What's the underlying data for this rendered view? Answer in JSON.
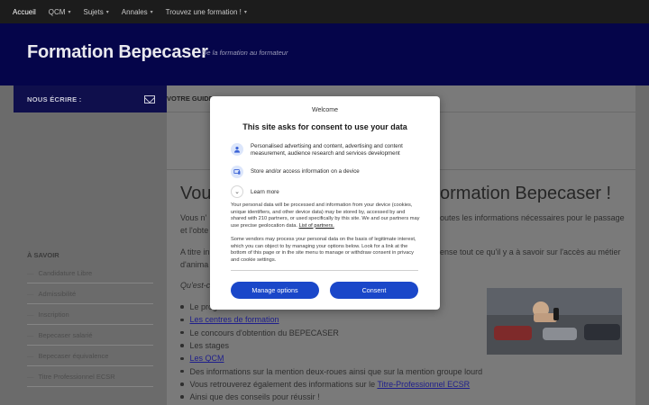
{
  "nav": {
    "items": [
      {
        "label": "Accueil",
        "active": true,
        "dropdown": false
      },
      {
        "label": "QCM",
        "dropdown": true
      },
      {
        "label": "Sujets",
        "dropdown": true
      },
      {
        "label": "Annales",
        "dropdown": true
      },
      {
        "label": "Trouvez une formation !",
        "dropdown": true
      }
    ]
  },
  "header": {
    "title": "Formation Bepecaser",
    "tagline": "De la formation au formateur"
  },
  "sidebar": {
    "contact_label": "NOUS ÉCRIRE :",
    "section_title": "À SAVOIR",
    "items": [
      "Candidature Libre",
      "Admissibilité",
      "Inscription",
      "Bepecaser salarié",
      "Bepecaser équivalence",
      "Titre Professionnel ECSR"
    ]
  },
  "main": {
    "guide_label": "VOTRE GUIDE",
    "heading_left": "Vous",
    "heading_right": "ormation Bepecaser !",
    "p1_left": "Vous n'",
    "p1_right": "outes les informations nécessaires pour le passage",
    "p1b_left": "et l'obte",
    "p2_left": "A titre in",
    "p2_right": "ense tout ce qu'il y a à savoir sur l'accès au métier",
    "p2b_left": "d'anima",
    "question_left": "Qu'est-c",
    "bullets": [
      {
        "text": "Le programme",
        "link": false
      },
      {
        "text": "Les centres de formation",
        "link": true
      },
      {
        "text": "Le concours d'obtention du BEPECASER",
        "link": false
      },
      {
        "text": "Les stages",
        "link": false
      },
      {
        "text": "Les QCM",
        "link": true
      },
      {
        "text": "Des informations sur la mention deux-roues ainsi que sur la mention groupe lourd",
        "link": false
      },
      {
        "text_before": "Vous retrouverez également des informations sur le ",
        "link_text": "Titre-Professionnel ECSR"
      },
      {
        "text": "Ainsi que des conseils pour réussir !",
        "link": false
      }
    ]
  },
  "consent": {
    "welcome": "Welcome",
    "title": "This site asks for consent to use your data",
    "purposes": [
      {
        "icon": "person-icon",
        "text": "Personalised advertising and content, advertising and content measurement, audience research and services development"
      },
      {
        "icon": "device-icon",
        "text": "Store and/or access information on a device"
      }
    ],
    "learn_more": "Learn more",
    "para1_text": "Your personal data will be processed and information from your device (cookies, unique identifiers, and other device data) may be stored by, accessed by and shared with 210 partners, or used specifically by this site. We and our partners may use precise geolocation data. ",
    "para1_link": "List of partners.",
    "para2": "Some vendors may process your personal data on the basis of legitimate interest, which you can object to by managing your options below. Look for a link at the bottom of this page or in the site menu to manage or withdraw consent in privacy and cookie settings.",
    "manage_label": "Manage options",
    "consent_label": "Consent",
    "accent": "#1a47c9"
  }
}
